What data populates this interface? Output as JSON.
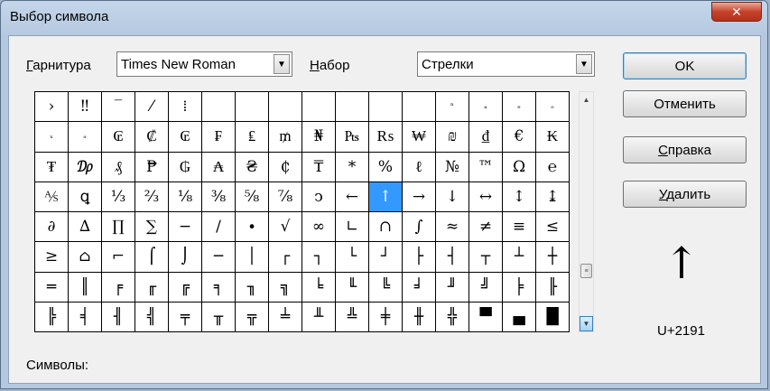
{
  "window": {
    "title": "Выбор символа",
    "close_icon": "close-icon"
  },
  "font_label": "Гарнитура",
  "font_value": "Times New Roman",
  "subset_label": "Набор",
  "subset_value": "Стрелки",
  "buttons": {
    "ok": "OK",
    "cancel": "Отменить",
    "help": "Справка",
    "delete": "Удалить"
  },
  "symbols_label": "Символы:",
  "preview_char": "↑",
  "preview_code": "U+2191",
  "selected_index": 73,
  "grid_cells": [
    "›",
    "‼",
    "‾",
    "⁄",
    "⁞",
    "",
    "",
    "",
    "",
    "",
    "",
    "",
    "ⁿ",
    "ₐ",
    "ₑ",
    "ₒ",
    "ₓ",
    "ₔ",
    "₢",
    "₡",
    "₢",
    "₣",
    "₤",
    "₥",
    "₦",
    "₧",
    "₨",
    "₩",
    "₪",
    "₫",
    "€",
    "₭",
    "₮",
    "₯",
    "₰",
    "₱",
    "₲",
    "₳",
    "₴",
    "₵",
    "₸",
    "*",
    "%",
    "ℓ",
    "№",
    "™",
    "Ω",
    "℮",
    "⅍",
    "ꝗ",
    "⅓",
    "⅔",
    "⅛",
    "⅜",
    "⅝",
    "⅞",
    "ↄ",
    "←",
    "↑",
    "→",
    "↓",
    "↔",
    "↕",
    "↨",
    "∂",
    "∆",
    "∏",
    "∑",
    "−",
    "∕",
    "∙",
    "√",
    "∞",
    "∟",
    "∩",
    "∫",
    "≈",
    "≠",
    "≡",
    "≤",
    "≥",
    "⌂",
    "⌐",
    "⌠",
    "⌡",
    "─",
    "│",
    "┌",
    "┐",
    "└",
    "┘",
    "├",
    "┤",
    "┬",
    "┴",
    "┼",
    "═",
    "║",
    "╒",
    "╓",
    "╔",
    "╕",
    "╖",
    "╗",
    "╘",
    "╙",
    "╚",
    "╛",
    "╜",
    "╝",
    "╞",
    "╟",
    "╠",
    "╡",
    "╢",
    "╣",
    "╤",
    "╥",
    "╦",
    "╧",
    "╨",
    "╩",
    "╪",
    "╫",
    "╬",
    "▀",
    "▄",
    "█",
    "▌"
  ]
}
